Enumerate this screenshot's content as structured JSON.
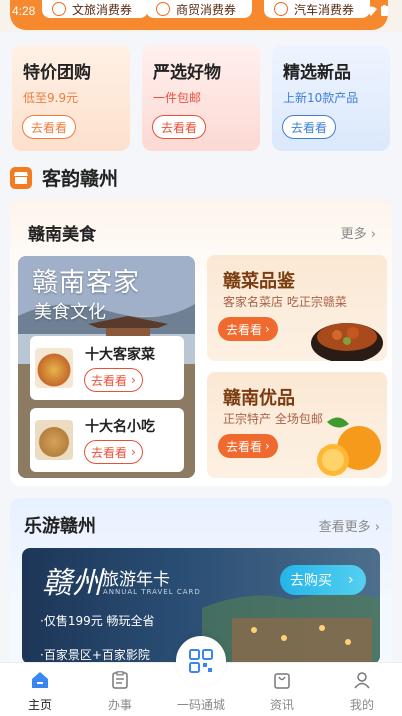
{
  "status": {
    "time": "4:28"
  },
  "coupons": [
    "文旅消费券",
    "商贸消费券",
    "汽车消费券"
  ],
  "promos": [
    {
      "title": "特价团购",
      "subtitle": "低至9.9元",
      "button": "去看看",
      "accent": "#f07b3c"
    },
    {
      "title": "严选好物",
      "subtitle": "一件包邮",
      "button": "去看看",
      "accent": "#e8503a"
    },
    {
      "title": "精选新品",
      "subtitle": "上新10款产品",
      "button": "去看看",
      "accent": "#3f7fd6"
    }
  ],
  "section": {
    "title": "客韵赣州"
  },
  "food": {
    "title": "赣南美食",
    "more": "更多",
    "feature_line1": "赣南客家",
    "feature_line2": "美食文化",
    "minis": [
      {
        "title": "十大客家菜",
        "button": "去看看"
      },
      {
        "title": "十大名小吃",
        "button": "去看看"
      }
    ],
    "cards": [
      {
        "title": "赣菜品鉴",
        "subtitle": "客家名菜店 吃正宗赣菜",
        "button": "去看看"
      },
      {
        "title": "赣南优品",
        "subtitle": "正宗特产 全场包邮",
        "button": "去看看"
      }
    ]
  },
  "travel": {
    "title": "乐游赣州",
    "more": "查看更多",
    "card_logo": "赣州",
    "card_title": "旅游年卡",
    "card_sub": "ANNUAL TRAVEL CARD",
    "buy": "去购买",
    "bullet1": "·仅售199元 畅玩全省",
    "bullet2": "·百家景区+百家影院"
  },
  "nav": [
    {
      "label": "主页",
      "icon": "home-icon",
      "active": true
    },
    {
      "label": "办事",
      "icon": "clipboard-icon",
      "active": false
    },
    {
      "label": "一码通城",
      "icon": "qr-code-icon",
      "active": false
    },
    {
      "label": "资讯",
      "icon": "bag-icon",
      "active": false
    },
    {
      "label": "我的",
      "icon": "user-icon",
      "active": false
    }
  ],
  "colors": {
    "orange": "#f6892d",
    "active_blue": "#3a86f0"
  }
}
